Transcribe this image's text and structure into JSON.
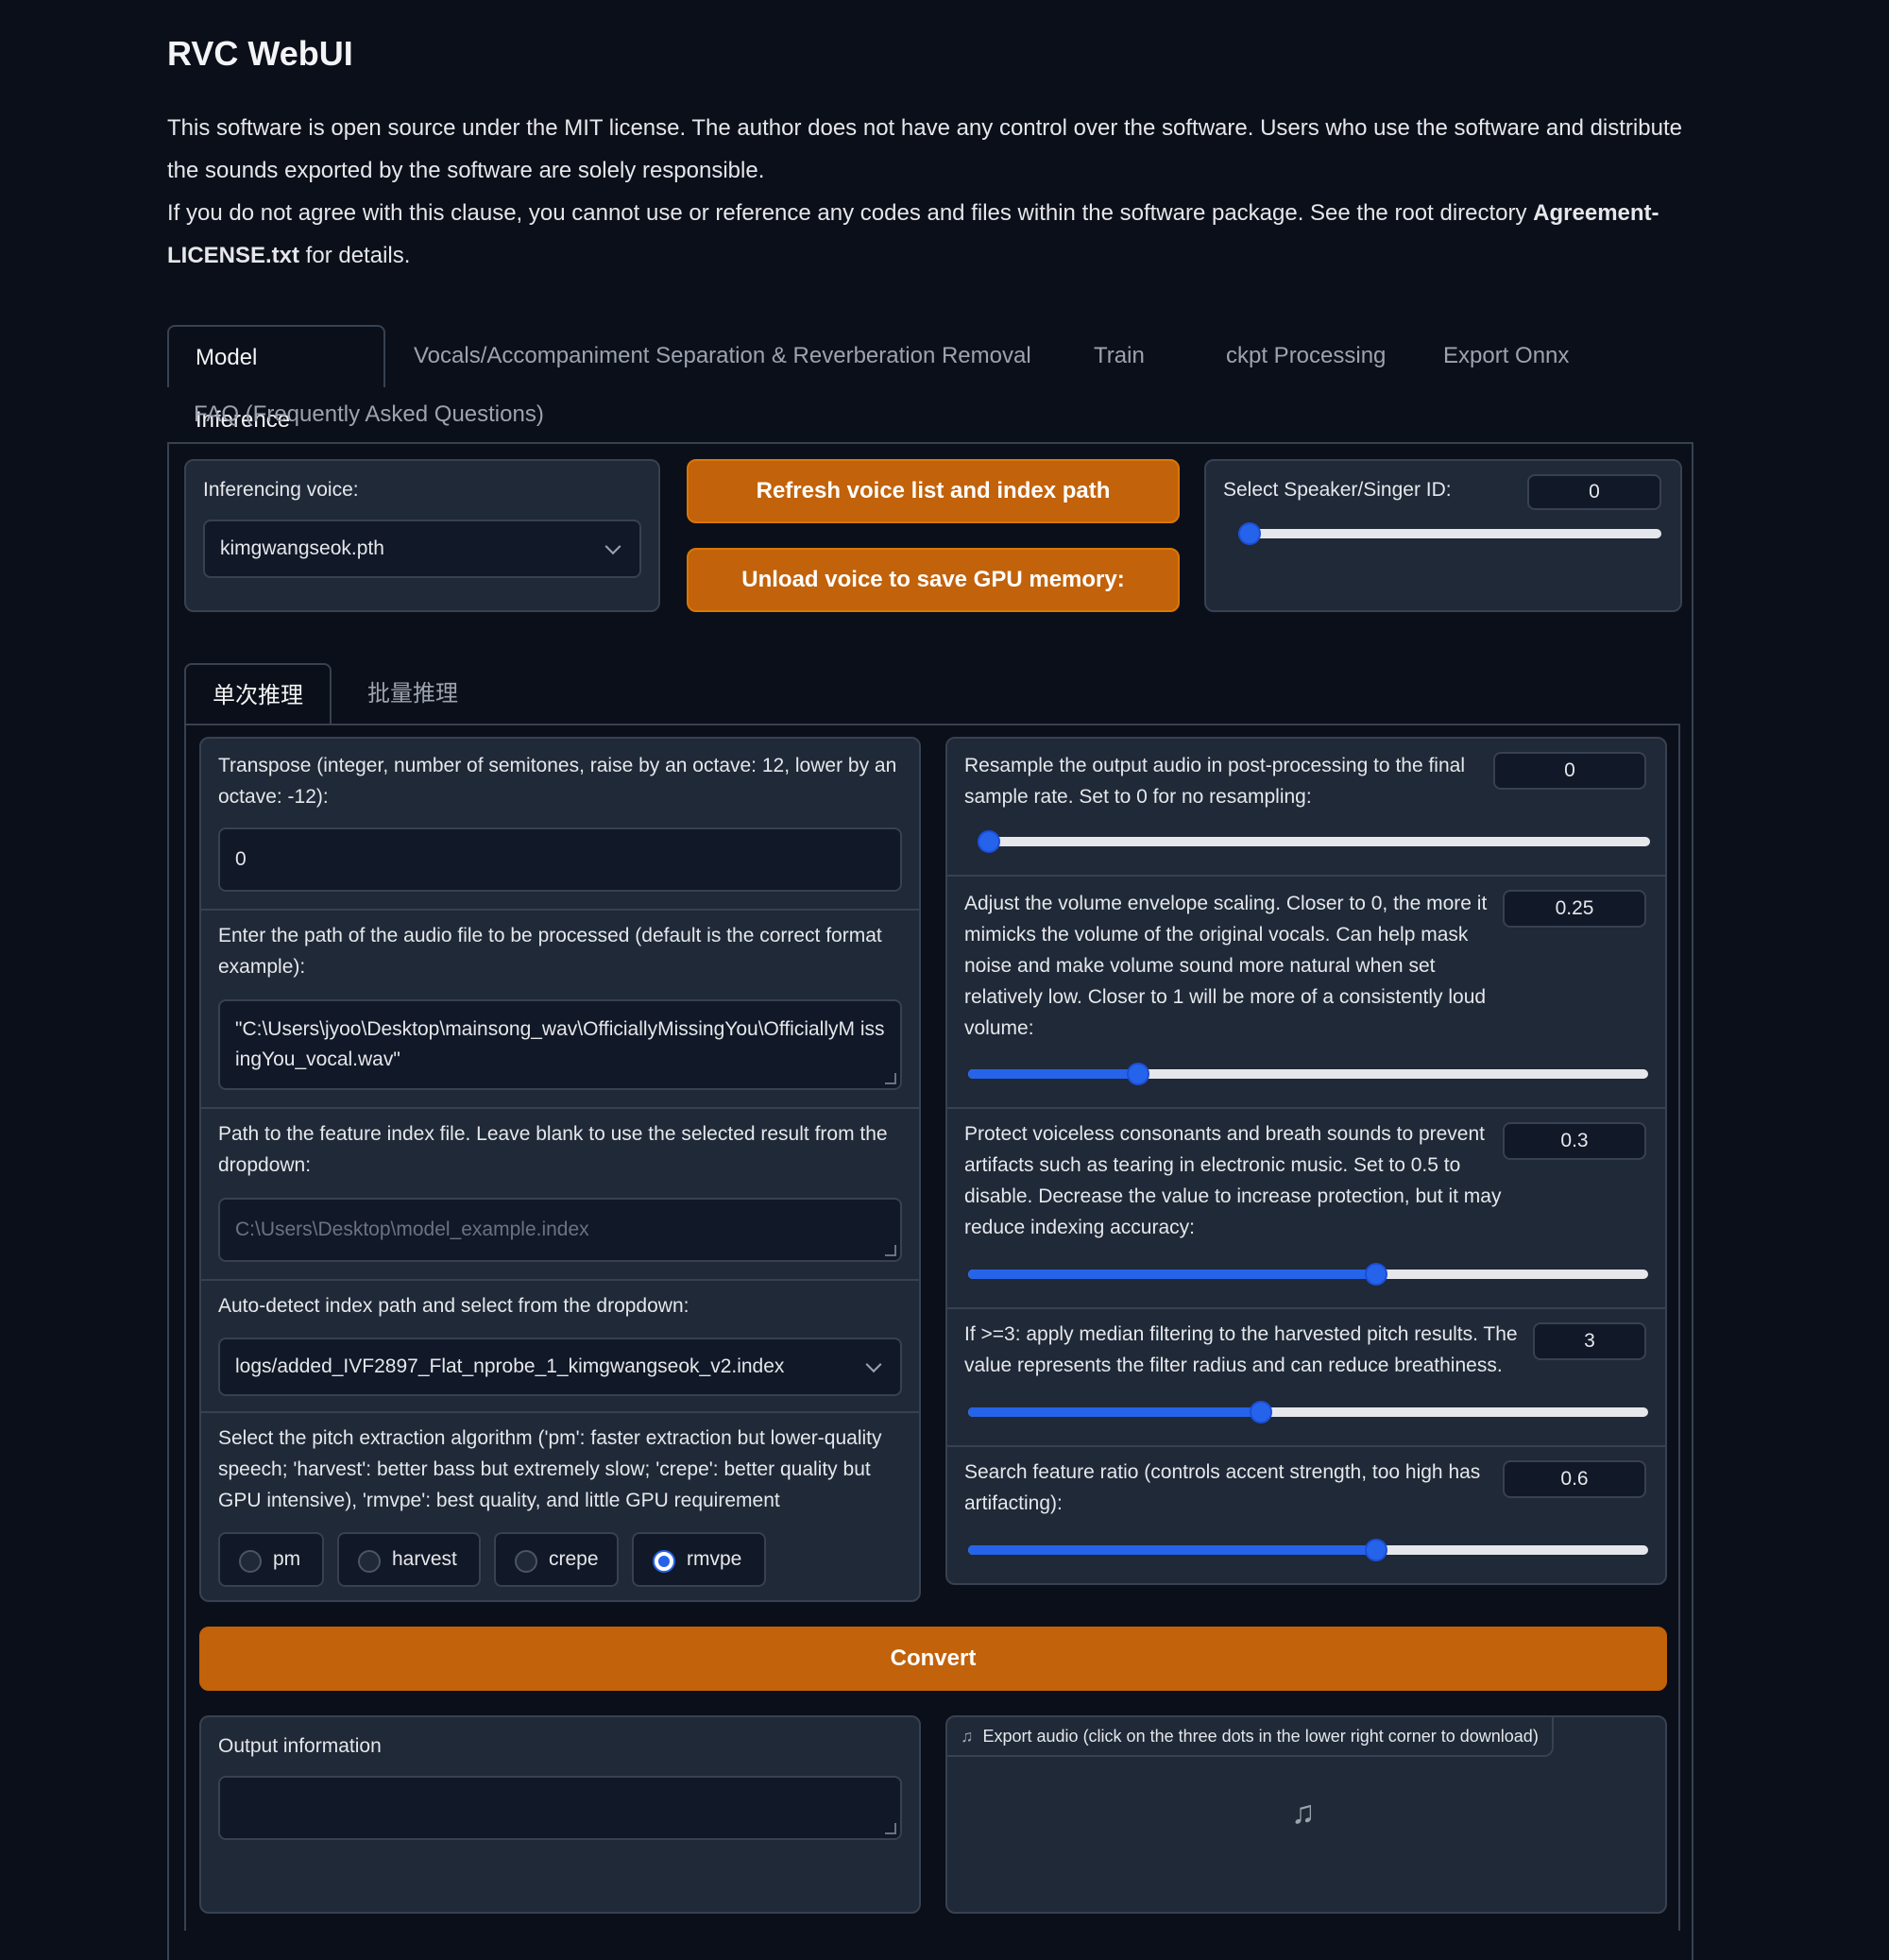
{
  "app": {
    "title": "RVC WebUI"
  },
  "intro": {
    "line1": "This software is open source under the MIT license. The author does not have any control over the software. Users who use the software and distribute the sounds exported by the software are solely responsible.",
    "line2_pre": "If you do not agree with this clause, you cannot use or reference any codes and files within the software package. See the root directory ",
    "line2_bold": "Agreement-LICENSE.txt",
    "line2_post": " for details."
  },
  "tabs": [
    {
      "label": "Model Inference",
      "active": true
    },
    {
      "label": "Vocals/Accompaniment Separation & Reverberation Removal"
    },
    {
      "label": "Train"
    },
    {
      "label": "ckpt Processing"
    },
    {
      "label": "Export Onnx"
    },
    {
      "label": "FAQ (Frequently Asked Questions)"
    }
  ],
  "top": {
    "voice_label": "Inferencing voice:",
    "voice_value": "kimgwangseok.pth",
    "refresh_btn": "Refresh voice list and index path",
    "unload_btn": "Unload voice to save GPU memory:",
    "speaker_label": "Select Speaker/Singer ID:",
    "speaker_value": "0",
    "speaker_fraction": 0.0
  },
  "subtabs": [
    {
      "label": "单次推理",
      "active": true
    },
    {
      "label": "批量推理"
    }
  ],
  "left": {
    "transpose_label": "Transpose (integer, number of semitones, raise by an octave: 12, lower by an octave: -12):",
    "transpose_value": "0",
    "audio_label": "Enter the path of the audio file to be processed (default is the correct format example):",
    "audio_value": "\"C:\\Users\\jyoo\\Desktop\\mainsong_wav\\OfficiallyMissingYou\\OfficiallyM issingYou_vocal.wav\"",
    "index_label": "Path to the feature index file. Leave blank to use the selected result from the dropdown:",
    "index_placeholder": "C:\\Users\\Desktop\\model_example.index",
    "auto_label": "Auto-detect index path and select from the dropdown:",
    "auto_value": "logs/added_IVF2897_Flat_nprobe_1_kimgwangseok_v2.index",
    "pitch_label": "Select the pitch extraction algorithm ('pm': faster extraction but lower-quality speech; 'harvest': better bass but extremely slow; 'crepe': better quality but GPU intensive), 'rmvpe': best quality, and little GPU requirement",
    "pitch_options": [
      "pm",
      "harvest",
      "crepe",
      "rmvpe"
    ],
    "pitch_selected": "rmvpe"
  },
  "right": {
    "resample_label": "Resample the output audio in post-processing to the final sample rate. Set to 0 for no resampling:",
    "resample_value": "0",
    "resample_fraction": 0.0,
    "volume_label": "Adjust the volume envelope scaling. Closer to 0, the more it mimicks the volume of the original vocals. Can help mask noise and make volume sound more natural when set relatively low. Closer to 1 will be more of a consistently loud volume:",
    "volume_value": "0.25",
    "volume_fraction": 0.25,
    "protect_label": "Protect voiceless consonants and breath sounds to prevent artifacts such as tearing in electronic music. Set to 0.5 to disable. Decrease the value to increase protection, but it may reduce indexing accuracy:",
    "protect_value": "0.3",
    "protect_fraction": 0.6,
    "median_label": "If >=3: apply median filtering to the harvested pitch results. The value represents the filter radius and can reduce breathiness.",
    "median_value": "3",
    "median_fraction": 0.43,
    "ratio_label": "Search feature ratio (controls accent strength, too high has artifacting):",
    "ratio_value": "0.6",
    "ratio_fraction": 0.6
  },
  "convert_btn": "Convert",
  "output": {
    "info_label": "Output information",
    "info_value": "",
    "export_label": "Export audio (click on the three dots in the lower right corner to download)"
  },
  "colors": {
    "accent": "#c2620a",
    "slider": "#2563eb",
    "bg": "#0b0f19",
    "panel": "#1f2937"
  }
}
